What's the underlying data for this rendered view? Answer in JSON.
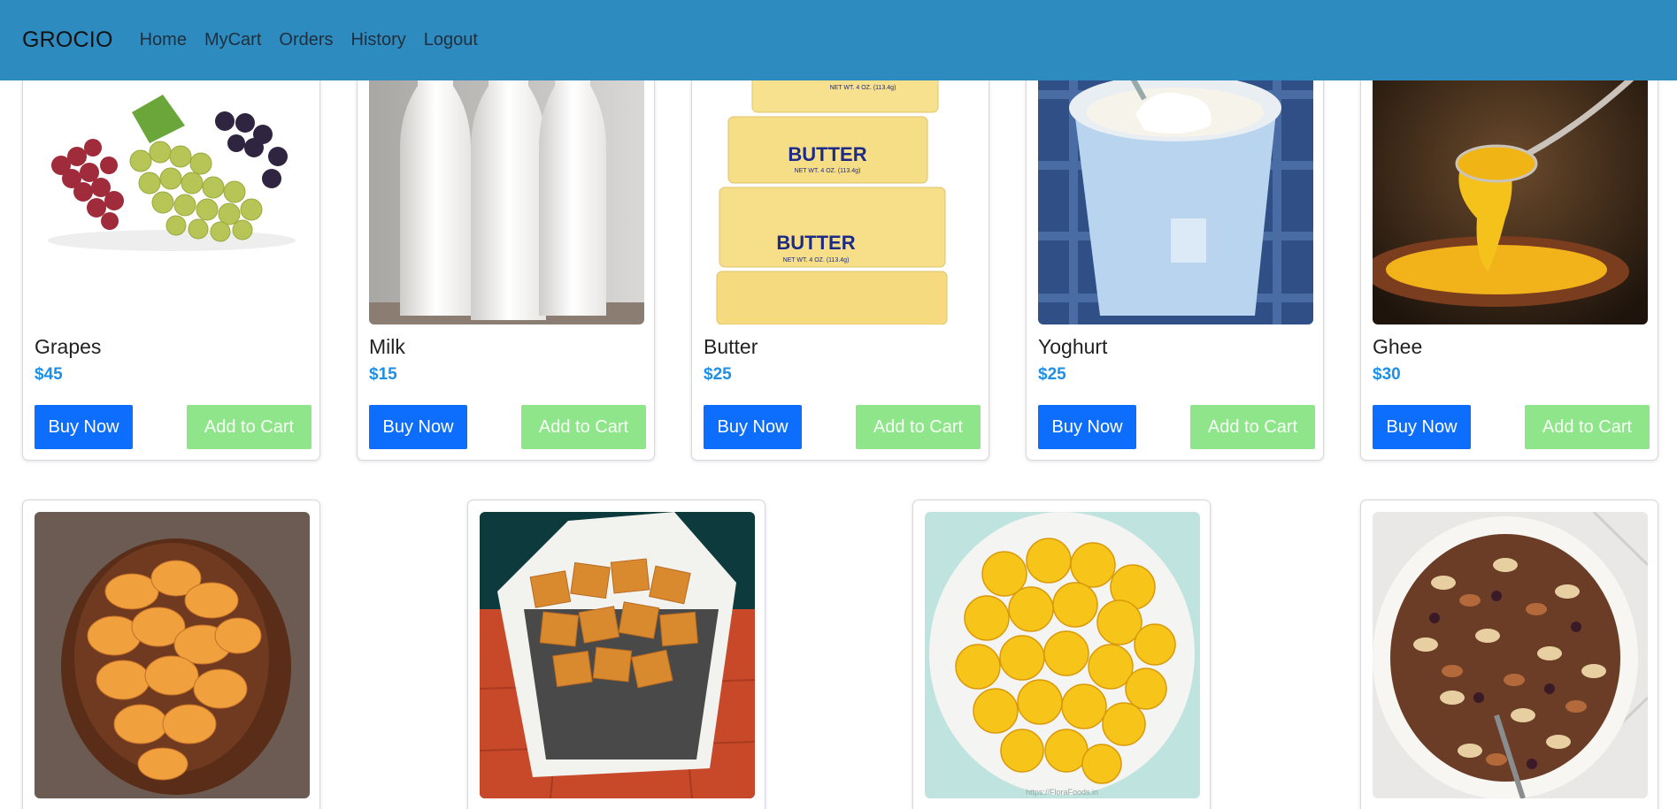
{
  "navbar": {
    "brand": "GROCIO",
    "links": [
      "Home",
      "MyCart",
      "Orders",
      "History",
      "Logout"
    ]
  },
  "products": [
    {
      "name": "Grapes",
      "price": "$45",
      "buy_label": "Buy Now",
      "add_label": "Add to Cart",
      "image": "grapes-image"
    },
    {
      "name": "Milk",
      "price": "$15",
      "buy_label": "Buy Now",
      "add_label": "Add to Cart",
      "image": "milk-bottles-image"
    },
    {
      "name": "Butter",
      "price": "$25",
      "buy_label": "Buy Now",
      "add_label": "Add to Cart",
      "image": "butter-image"
    },
    {
      "name": "Yoghurt",
      "price": "$25",
      "buy_label": "Buy Now",
      "add_label": "Add to Cart",
      "image": "yoghurt-image"
    },
    {
      "name": "Ghee",
      "price": "$30",
      "buy_label": "Buy Now",
      "add_label": "Add to Cart",
      "image": "ghee-image"
    }
  ],
  "products_row2": [
    {
      "image": "potato-chips-image"
    },
    {
      "image": "crackers-basket-image"
    },
    {
      "image": "banana-chips-image",
      "watermark": "https://FloraFoods.in"
    },
    {
      "image": "mixed-nuts-image"
    }
  ],
  "images": {
    "butter_text": "BUTTER",
    "butter_weight": "NET WT. 4 OZ. (113.4g)"
  }
}
